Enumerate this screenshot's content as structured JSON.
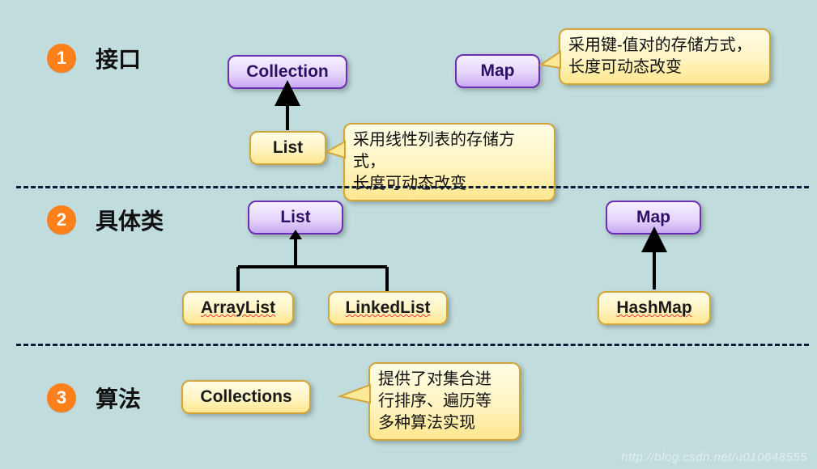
{
  "sections": {
    "s1": {
      "num": "1",
      "title": "接口"
    },
    "s2": {
      "num": "2",
      "title": "具体类"
    },
    "s3": {
      "num": "3",
      "title": "算法"
    }
  },
  "boxes": {
    "collection": "Collection",
    "map_top": "Map",
    "list_iface": "List",
    "list_class": "List",
    "map_class": "Map",
    "arraylist": "ArrayList",
    "linkedlist": "LinkedList",
    "hashmap": "HashMap",
    "collections": "Collections"
  },
  "callouts": {
    "map_note_l1": "采用键-值对的存储方式，",
    "map_note_l2": "长度可动态改变",
    "list_note_l1": "采用线性列表的存储方式，",
    "list_note_l2": "长度可动态改变",
    "algo_note_l1": "提供了对集合进",
    "algo_note_l2": "行排序、遍历等",
    "algo_note_l3": "多种算法实现"
  },
  "watermark": "http://blog.csdn.net/u010648555"
}
